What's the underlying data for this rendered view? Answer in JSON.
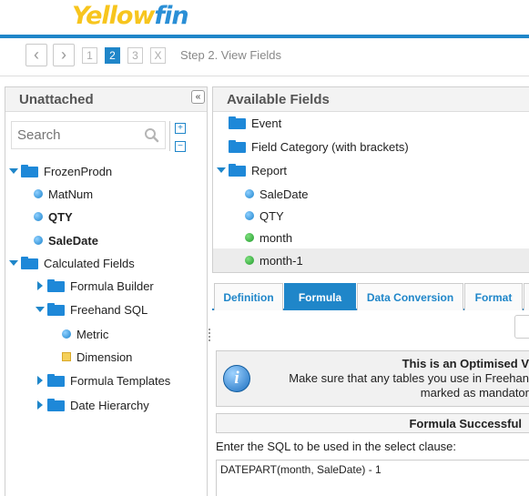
{
  "app": {
    "logo_yellow": "Yellow",
    "logo_blue": "fin",
    "accent_color": "#1f86c9"
  },
  "stepbar": {
    "steps": [
      "1",
      "2",
      "3",
      "X"
    ],
    "active_step": "2",
    "label": "Step 2. View Fields"
  },
  "left_panel": {
    "title": "Unattached",
    "collapse_label": "«",
    "search_placeholder": "Search",
    "expand_all_label": "+",
    "collapse_all_label": "−",
    "tree": {
      "frozenprodn": "FrozenProdn",
      "matnum": "MatNum",
      "qty": "QTY",
      "saledate": "SaleDate",
      "calculated_fields": "Calculated Fields",
      "formula_builder": "Formula Builder",
      "freehand_sql": "Freehand SQL",
      "metric": "Metric",
      "dimension": "Dimension",
      "formula_templates": "Formula Templates",
      "date_hierarchy": "Date Hierarchy"
    }
  },
  "right_panel": {
    "title": "Available Fields",
    "tree": {
      "event": "Event",
      "field_category": "Field Category (with brackets)",
      "report": "Report",
      "saledate": "SaleDate",
      "qty": "QTY",
      "month": "month",
      "month_1": "month-1"
    }
  },
  "tabs": {
    "definition": "Definition",
    "formula": "Formula",
    "data_conversion": "Data Conversion",
    "format": "Format",
    "active": "Formula"
  },
  "formula": {
    "notice_line1": "This is an Optimised V",
    "notice_line2": "Make sure that any tables you use in Freehan",
    "notice_line3": "marked as mandator",
    "success": "Formula Successful",
    "sql_label": "Enter the SQL to be used in the select clause:",
    "sql_value": "DATEPART(month, SaleDate) - 1"
  }
}
